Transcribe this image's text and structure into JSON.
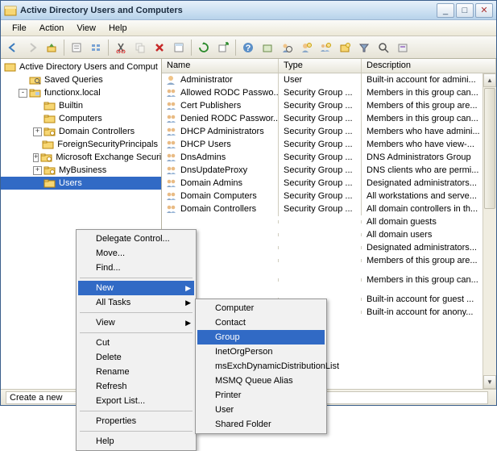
{
  "title": "Active Directory Users and Computers",
  "winbtns": {
    "min": "_",
    "max": "□",
    "close": "✕"
  },
  "menubar": [
    "File",
    "Action",
    "View",
    "Help"
  ],
  "tree": {
    "root": "Active Directory Users and Comput",
    "items": [
      {
        "pad": 22,
        "exp": "",
        "icon": "search",
        "label": "Saved Queries"
      },
      {
        "pad": 22,
        "exp": "-",
        "icon": "domain",
        "label": "functionx.local"
      },
      {
        "pad": 40,
        "exp": "",
        "icon": "folder",
        "label": "Builtin"
      },
      {
        "pad": 40,
        "exp": "",
        "icon": "folder",
        "label": "Computers"
      },
      {
        "pad": 40,
        "exp": "+",
        "icon": "ou",
        "label": "Domain Controllers"
      },
      {
        "pad": 40,
        "exp": "",
        "icon": "folder",
        "label": "ForeignSecurityPrincipals"
      },
      {
        "pad": 40,
        "exp": "+",
        "icon": "ou",
        "label": "Microsoft Exchange Securit"
      },
      {
        "pad": 40,
        "exp": "+",
        "icon": "ou",
        "label": "MyBusiness"
      },
      {
        "pad": 40,
        "exp": "",
        "icon": "folder",
        "label": "Users",
        "sel": true
      }
    ]
  },
  "columns": [
    "Name",
    "Type",
    "Description"
  ],
  "rows": [
    {
      "i": "user",
      "n": "Administrator",
      "t": "User",
      "d": "Built-in account for admini..."
    },
    {
      "i": "group",
      "n": "Allowed RODC Passwo...",
      "t": "Security Group ...",
      "d": "Members in this group can..."
    },
    {
      "i": "group",
      "n": "Cert Publishers",
      "t": "Security Group ...",
      "d": "Members of this group are..."
    },
    {
      "i": "group",
      "n": "Denied RODC Passwor...",
      "t": "Security Group ...",
      "d": "Members in this group can..."
    },
    {
      "i": "group",
      "n": "DHCP Administrators",
      "t": "Security Group ...",
      "d": "Members who have admini..."
    },
    {
      "i": "group",
      "n": "DHCP Users",
      "t": "Security Group ...",
      "d": "Members who have view-..."
    },
    {
      "i": "group",
      "n": "DnsAdmins",
      "t": "Security Group ...",
      "d": "DNS Administrators Group"
    },
    {
      "i": "group",
      "n": "DnsUpdateProxy",
      "t": "Security Group ...",
      "d": "DNS clients who are permi..."
    },
    {
      "i": "group",
      "n": "Domain Admins",
      "t": "Security Group ...",
      "d": "Designated administrators..."
    },
    {
      "i": "group",
      "n": "Domain Computers",
      "t": "Security Group ...",
      "d": "All workstations and serve..."
    },
    {
      "i": "group",
      "n": "Domain Controllers",
      "t": "Security Group ...",
      "d": "All domain controllers in th..."
    },
    {
      "i": "",
      "n": "",
      "t": "",
      "d": "All domain guests",
      "pad": true
    },
    {
      "i": "",
      "n": "",
      "t": "",
      "d": "All domain users",
      "pad": true
    },
    {
      "i": "",
      "n": "",
      "t": "",
      "d": "Designated administrators...",
      "pad": true
    },
    {
      "i": "",
      "n": "",
      "t": "",
      "d": "Members of this group are...",
      "pad": true
    },
    {
      "i": "",
      "n": "",
      "t": "",
      "d": "",
      "pad": true,
      "gap": true
    },
    {
      "i": "",
      "n": "",
      "t": "",
      "d": "Members in this group can...",
      "pad": true
    },
    {
      "i": "",
      "n": "",
      "t": "",
      "d": "",
      "pad": true,
      "gap": true
    },
    {
      "i": "",
      "n": "",
      "t": "",
      "d": "Built-in account for guest ...",
      "pad": true
    },
    {
      "i": "",
      "n": "",
      "t": "",
      "d": "Built-in account for anony...",
      "pad": true
    }
  ],
  "context": {
    "main": [
      {
        "l": "Delegate Control..."
      },
      {
        "l": "Move..."
      },
      {
        "l": "Find..."
      },
      {
        "sep": true
      },
      {
        "l": "New",
        "sub": true,
        "hi": true
      },
      {
        "l": "All Tasks",
        "sub": true
      },
      {
        "sep": true
      },
      {
        "l": "View",
        "sub": true
      },
      {
        "sep": true
      },
      {
        "l": "Cut"
      },
      {
        "l": "Delete"
      },
      {
        "l": "Rename"
      },
      {
        "l": "Refresh"
      },
      {
        "l": "Export List..."
      },
      {
        "sep": true
      },
      {
        "l": "Properties"
      },
      {
        "sep": true
      },
      {
        "l": "Help"
      }
    ],
    "sub": [
      {
        "l": "Computer"
      },
      {
        "l": "Contact"
      },
      {
        "l": "Group",
        "hi": true
      },
      {
        "l": "InetOrgPerson"
      },
      {
        "l": "msExchDynamicDistributionList"
      },
      {
        "l": "MSMQ Queue Alias"
      },
      {
        "l": "Printer"
      },
      {
        "l": "User"
      },
      {
        "l": "Shared Folder"
      }
    ]
  },
  "status": "Create a new ob"
}
